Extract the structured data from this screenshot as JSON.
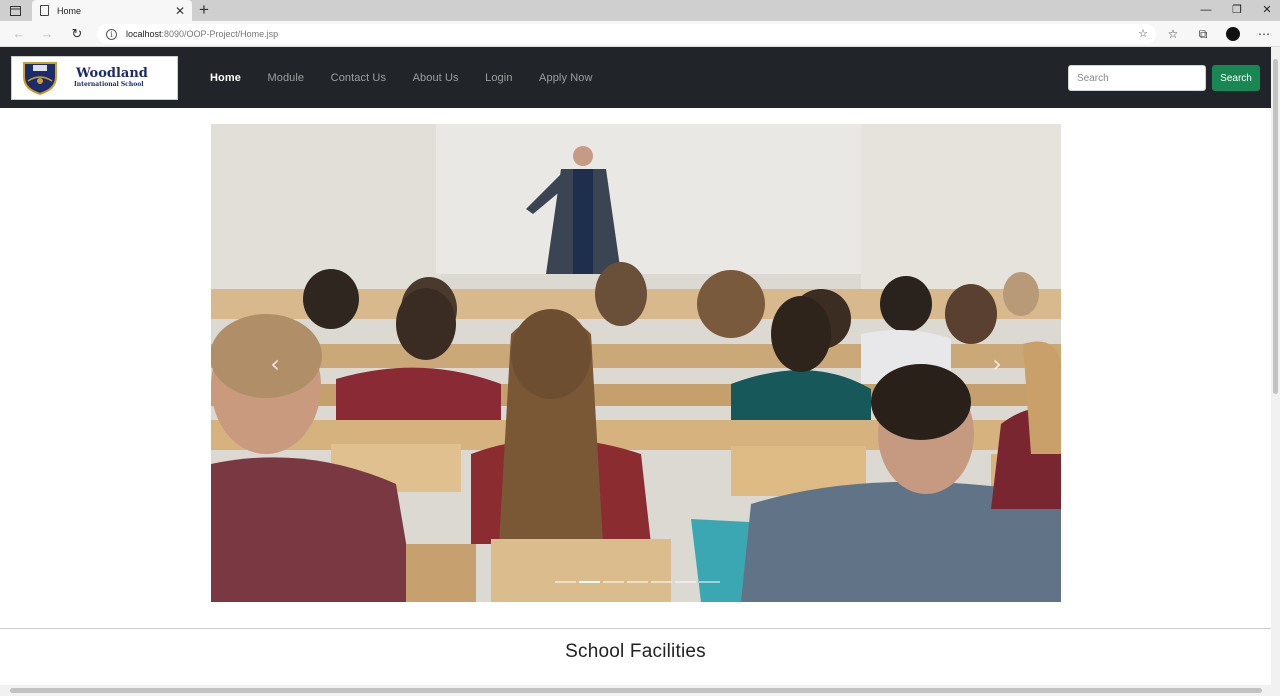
{
  "browser": {
    "tab": {
      "title": "Home",
      "icon": "page-icon"
    },
    "url": {
      "host": "localhost",
      "path": ":8090/OOP-Project/Home.jsp"
    }
  },
  "navbar": {
    "brand": {
      "name": "Woodland",
      "subtitle": "International School",
      "crest_text": "WIS"
    },
    "links": [
      {
        "label": "Home",
        "active": true
      },
      {
        "label": "Module",
        "active": false
      },
      {
        "label": "Contact Us",
        "active": false
      },
      {
        "label": "About Us",
        "active": false
      },
      {
        "label": "Login",
        "active": false
      },
      {
        "label": "Apply Now",
        "active": false
      }
    ],
    "search": {
      "placeholder": "Search",
      "button_label": "Search"
    }
  },
  "carousel": {
    "slide_count": 7,
    "active_index": 1,
    "image": "classroom-lecture-photo"
  },
  "sections": {
    "facilities_title": "School Facilities"
  },
  "colors": {
    "navbar_bg": "#212529",
    "search_button": "#198754",
    "brand_text": "#1d2a6b"
  }
}
